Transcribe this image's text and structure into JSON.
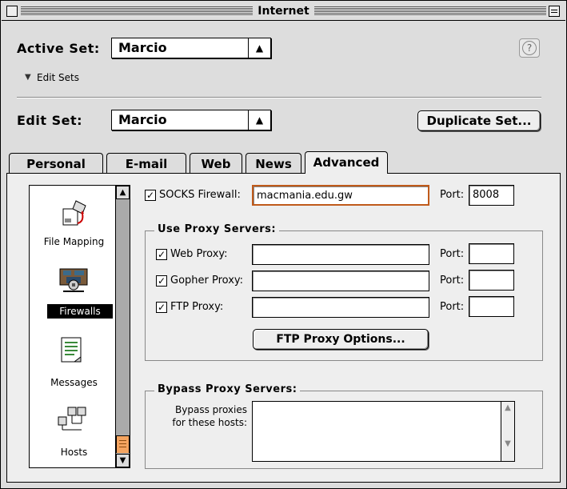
{
  "window": {
    "title": "Internet"
  },
  "active_set": {
    "label": "Active Set:",
    "value": "Marcio"
  },
  "edit_sets_toggle": "Edit Sets",
  "help_icon": "?",
  "edit_set": {
    "label": "Edit Set:",
    "value": "Marcio",
    "duplicate_label": "Duplicate Set..."
  },
  "tabs": [
    {
      "label": "Personal"
    },
    {
      "label": "E-mail"
    },
    {
      "label": "Web"
    },
    {
      "label": "News"
    },
    {
      "label": "Advanced",
      "selected": true
    }
  ],
  "sidebar": {
    "items": [
      {
        "label": "File Mapping",
        "icon": "file-mapping-icon"
      },
      {
        "label": "Firewalls",
        "icon": "firewalls-icon",
        "selected": true
      },
      {
        "label": "Messages",
        "icon": "messages-icon"
      },
      {
        "label": "Hosts",
        "icon": "hosts-icon"
      }
    ]
  },
  "socks": {
    "label": "SOCKS Firewall:",
    "value": "macmania.edu.gw",
    "port_label": "Port:",
    "port": "8008",
    "checked": true
  },
  "proxy": {
    "group_title": "Use Proxy Servers:",
    "web": {
      "label": "Web Proxy:",
      "value": "",
      "port_label": "Port:",
      "port": "",
      "checked": true
    },
    "gopher": {
      "label": "Gopher Proxy:",
      "value": "",
      "port_label": "Port:",
      "port": "",
      "checked": true
    },
    "ftp": {
      "label": "FTP Proxy:",
      "value": "",
      "port_label": "Port:",
      "port": "",
      "checked": true
    },
    "ftp_options_label": "FTP Proxy Options..."
  },
  "bypass": {
    "group_title": "Bypass Proxy Servers:",
    "label_line1": "Bypass proxies",
    "label_line2": "for these hosts:",
    "value": ""
  },
  "colors": {
    "focus_ring": "#c05a1a",
    "scroll_thumb": "#f4a460"
  }
}
